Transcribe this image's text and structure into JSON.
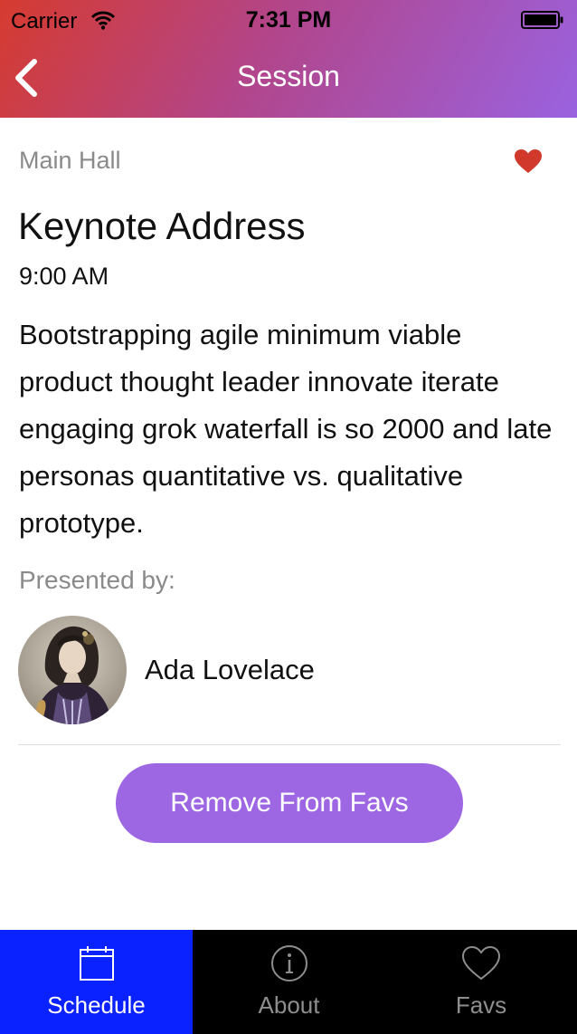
{
  "status_bar": {
    "carrier": "Carrier",
    "time": "7:31 PM"
  },
  "nav": {
    "title": "Session",
    "back_icon": "chevron-left-icon"
  },
  "session": {
    "room": "Main Hall",
    "title": "Keynote Address",
    "time": "9:00 AM",
    "description": "Bootstrapping agile minimum viable product thought leader innovate iterate engaging grok waterfall is so 2000 and late personas quantitative vs. qualitative prototype.",
    "favorited": true,
    "heart_color": "#d0392b"
  },
  "presenter": {
    "label": "Presented by:",
    "name": "Ada Lovelace"
  },
  "actions": {
    "fav_button": "Remove From Favs",
    "button_color": "#9d66e3"
  },
  "tabs": [
    {
      "label": "Schedule",
      "icon": "calendar-icon",
      "selected": true
    },
    {
      "label": "About",
      "icon": "info-icon",
      "selected": false
    },
    {
      "label": "Favs",
      "icon": "heart-icon",
      "selected": false
    }
  ],
  "colors": {
    "tab_selected": "#0a22ff",
    "tab_bar": "#000000",
    "header_start": "#d63b2f",
    "header_end": "#9a62e0"
  }
}
